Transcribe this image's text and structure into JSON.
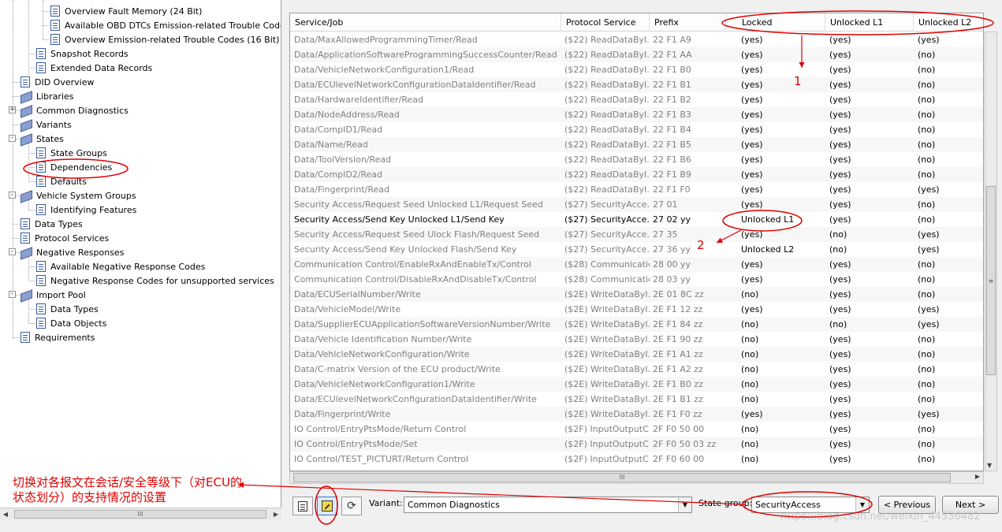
{
  "tree": {
    "items": [
      {
        "label": "Overview Fault Memory (24 Bit)",
        "icon": "document-icon"
      },
      {
        "label": "Available OBD DTCs Emission-related Trouble Codes (",
        "icon": "document-icon"
      },
      {
        "label": "Overview Emission-related Trouble Codes (16 Bit)",
        "icon": "document-icon"
      },
      {
        "label": "Snapshot Records",
        "icon": "document-icon"
      },
      {
        "label": "Extended Data Records",
        "icon": "document-icon"
      },
      {
        "label": "DID Overview",
        "icon": "document-icon"
      },
      {
        "label": "Libraries",
        "icon": "books-icon"
      },
      {
        "label": "Common Diagnostics",
        "icon": "books-icon"
      },
      {
        "label": "Variants",
        "icon": "books-icon"
      },
      {
        "label": "States",
        "icon": "books-icon"
      },
      {
        "label": "State Groups",
        "icon": "document-icon"
      },
      {
        "label": "Dependencies",
        "icon": "document-icon"
      },
      {
        "label": "Defaults",
        "icon": "document-icon"
      },
      {
        "label": "Vehicle System Groups",
        "icon": "books-icon"
      },
      {
        "label": "Identifying Features",
        "icon": "document-icon"
      },
      {
        "label": "Data Types",
        "icon": "document-icon"
      },
      {
        "label": "Protocol Services",
        "icon": "document-icon"
      },
      {
        "label": "Negative Responses",
        "icon": "books-icon"
      },
      {
        "label": "Available Negative Response Codes",
        "icon": "document-icon"
      },
      {
        "label": "Negative Response Codes for unsupported services",
        "icon": "document-icon"
      },
      {
        "label": "Import Pool",
        "icon": "books-icon"
      },
      {
        "label": "Data Types",
        "icon": "document-icon"
      },
      {
        "label": "Data Objects",
        "icon": "document-icon"
      },
      {
        "label": "Requirements",
        "icon": "document-icon"
      }
    ],
    "scroll_grip": "III"
  },
  "annotation": {
    "note": "切换对各报文在会话/安全等级下（对ECU的状态划分）的支持情况的设置",
    "marker_1": "1",
    "marker_2": "2",
    "color": "#e00000"
  },
  "grid": {
    "columns": [
      "Service/Job",
      "Protocol Service",
      "Prefix",
      "Locked",
      "Unlocked L1",
      "Unlocked L2"
    ],
    "rows": [
      [
        "Data/MaxAllowedProgrammingTimer/Read",
        "($22) ReadDataByI...",
        "22 F1 A9",
        "(yes)",
        "(yes)",
        "(yes)"
      ],
      [
        "Data/ApplicationSoftwareProgrammingSuccessCounter/Read",
        "($22) ReadDataByI...",
        "22 F1 AA",
        "(yes)",
        "(yes)",
        "(no)"
      ],
      [
        "Data/VehicleNetworkConfiguration1/Read",
        "($22) ReadDataByI...",
        "22 F1 B0",
        "(yes)",
        "(yes)",
        "(no)"
      ],
      [
        "Data/ECUlevelNetworkConfigurationDataIdentifier/Read",
        "($22) ReadDataByI...",
        "22 F1 B1",
        "(yes)",
        "(yes)",
        "(no)"
      ],
      [
        "Data/HardwareIdentifier/Read",
        "($22) ReadDataByI...",
        "22 F1 B2",
        "(yes)",
        "(yes)",
        "(no)"
      ],
      [
        "Data/NodeAddress/Read",
        "($22) ReadDataByI...",
        "22 F1 B3",
        "(yes)",
        "(yes)",
        "(no)"
      ],
      [
        "Data/CompID1/Read",
        "($22) ReadDataByI...",
        "22 F1 B4",
        "(yes)",
        "(yes)",
        "(no)"
      ],
      [
        "Data/Name/Read",
        "($22) ReadDataByI...",
        "22 F1 B5",
        "(yes)",
        "(yes)",
        "(no)"
      ],
      [
        "Data/ToolVersion/Read",
        "($22) ReadDataByI...",
        "22 F1 B6",
        "(yes)",
        "(yes)",
        "(no)"
      ],
      [
        "Data/CompID2/Read",
        "($22) ReadDataByI...",
        "22 F1 B9",
        "(yes)",
        "(yes)",
        "(no)"
      ],
      [
        "Data/Fingerprint/Read",
        "($22) ReadDataByI...",
        "22 F1 F0",
        "(yes)",
        "(yes)",
        "(yes)"
      ],
      [
        "Security Access/Request Seed Unlocked L1/Request Seed",
        "($27) SecurityAcce...",
        "27 01",
        "(yes)",
        "(yes)",
        "(no)"
      ],
      [
        "Security Access/Send Key Unlocked L1/Send Key",
        "($27) SecurityAcce...",
        "27 02 yy",
        "Unlocked L1",
        "(yes)",
        "(no)"
      ],
      [
        "Security Access/Request Seed Ulock Flash/Request Seed",
        "($27) SecurityAcce...",
        "27 35",
        "(yes)",
        "(no)",
        "(yes)"
      ],
      [
        "Security Access/Send Key Unlocked Flash/Send Key",
        "($27) SecurityAcce...",
        "27 36 yy",
        "Unlocked L2",
        "(no)",
        "(yes)"
      ],
      [
        "Communication Control/EnableRxAndEnableTx/Control",
        "($28) Communicatio...",
        "28 00 yy",
        "(yes)",
        "(yes)",
        "(no)"
      ],
      [
        "Communication Control/DisableRxAndDisableTx/Control",
        "($28) Communicatio...",
        "28 03 yy",
        "(yes)",
        "(yes)",
        "(no)"
      ],
      [
        "Data/ECUSerialNumber/Write",
        "($2E) WriteDataByI...",
        "2E 01 8C zz",
        "(no)",
        "(yes)",
        "(no)"
      ],
      [
        "Data/VehicleModel/Write",
        "($2E) WriteDataByI...",
        "2E F1 12 zz",
        "(yes)",
        "(yes)",
        "(yes)"
      ],
      [
        "Data/SupplierECUApplicationSoftwareVersionNumber/Write",
        "($2E) WriteDataByI...",
        "2E F1 84 zz",
        "(no)",
        "(no)",
        "(yes)"
      ],
      [
        "Data/Vehicle Identification Number/Write",
        "($2E) WriteDataByI...",
        "2E F1 90 zz",
        "(no)",
        "(yes)",
        "(no)"
      ],
      [
        "Data/VehicleNetworkConfiguration/Write",
        "($2E) WriteDataByI...",
        "2E F1 A1 zz",
        "(no)",
        "(yes)",
        "(no)"
      ],
      [
        "Data/C-matrix Version of the ECU product/Write",
        "($2E) WriteDataByI...",
        "2E F1 A2 zz",
        "(no)",
        "(yes)",
        "(no)"
      ],
      [
        "Data/VehicleNetworkConfiguration1/Write",
        "($2E) WriteDataByI...",
        "2E F1 B0 zz",
        "(no)",
        "(yes)",
        "(no)"
      ],
      [
        "Data/ECUlevelNetworkConfigurationDataIdentifier/Write",
        "($2E) WriteDataByI...",
        "2E F1 B1 zz",
        "(no)",
        "(yes)",
        "(no)"
      ],
      [
        "Data/Fingerprint/Write",
        "($2E) WriteDataByI...",
        "2E F1 F0 zz",
        "(yes)",
        "(yes)",
        "(yes)"
      ],
      [
        "IO Control/EntryPtsMode/Return Control",
        "($2F) InputOutputC...",
        "2F F0 50 00",
        "(no)",
        "(yes)",
        "(no)"
      ],
      [
        "IO Control/EntryPtsMode/Set",
        "($2F) InputOutputC...",
        "2F F0 50 03 zz",
        "(no)",
        "(yes)",
        "(no)"
      ],
      [
        "IO Control/TEST_PICTURT/Return Control",
        "($2F) InputOutputC...",
        "2F F0 60 00",
        "(no)",
        "(yes)",
        "(no)"
      ]
    ],
    "selected_row": 12,
    "vscroll_grip": "≡",
    "hscroll_grip": "III"
  },
  "toolbar": {
    "variant_label": "Variant:",
    "variant_value": "Common Diagnostics",
    "state_group_label": "State group:",
    "state_group_value": "SecurityAccess",
    "previous_label": "< Previous",
    "next_label": "Next >"
  },
  "watermark": "https://blog.csdn.net/weixin_44536482"
}
